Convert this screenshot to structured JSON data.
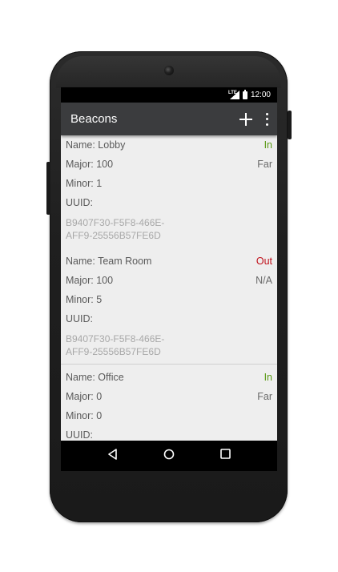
{
  "statusbar": {
    "time": "12:00",
    "network": "LTE"
  },
  "appbar": {
    "title": "Beacons"
  },
  "beacons": [
    {
      "name": "Name: Lobby",
      "state": "In",
      "major": "Major: 100",
      "proximity": "Far",
      "minor": "Minor: 1",
      "uuid_label": "UUID:",
      "uuid": "B9407F30-F5F8-466E-\nAFF9-25556B57FE6D"
    },
    {
      "name": "Name: Team Room",
      "state": "Out",
      "major": "Major: 100",
      "proximity": "N/A",
      "minor": "Minor: 5",
      "uuid_label": "UUID:",
      "uuid": "B9407F30-F5F8-466E-\nAFF9-25556B57FE6D"
    },
    {
      "name": "Name: Office",
      "state": "In",
      "major": "Major: 0",
      "proximity": "Far",
      "minor": "Minor: 0",
      "uuid_label": "UUID:"
    }
  ],
  "colors": {
    "in": "#5a9a14",
    "out": "#c0101a",
    "appbar": "#3b3c3e"
  },
  "icons": [
    "add-icon",
    "overflow-menu-icon",
    "back-icon",
    "home-icon",
    "recents-icon"
  ]
}
